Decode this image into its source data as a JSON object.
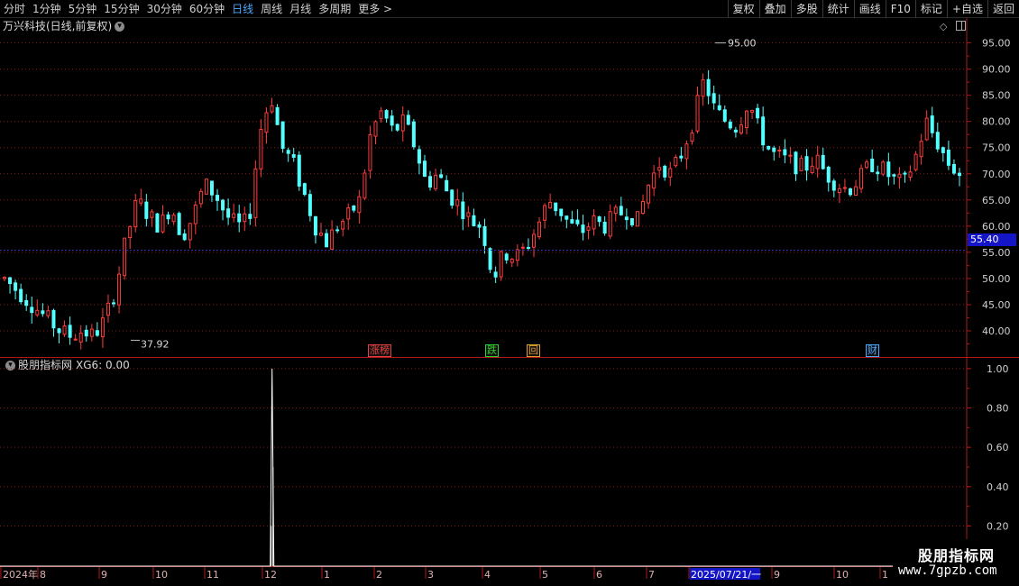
{
  "toolbar": {
    "timeframes": [
      "分时",
      "1分钟",
      "5分钟",
      "15分钟",
      "30分钟",
      "60分钟",
      "日线",
      "周线",
      "月线",
      "多周期",
      "更多 >"
    ],
    "active_index": 6,
    "tools": [
      "复权",
      "叠加",
      "多股",
      "统计",
      "画线",
      "F10",
      "标记",
      "+自选",
      "返回"
    ]
  },
  "main_chart": {
    "title": "万兴科技(日线,前复权)",
    "high_label": "95.00",
    "low_label": "37.92",
    "current_price": "55.40",
    "y_ticks": [
      "95.00",
      "90.00",
      "85.00",
      "80.00",
      "75.00",
      "70.00",
      "65.00",
      "60.00",
      "55.00",
      "50.00",
      "45.00",
      "40.00"
    ],
    "events": [
      {
        "text": "涨榜",
        "color": "#e84040"
      },
      {
        "text": "跌",
        "color": "#30d030"
      },
      {
        "text": "回",
        "color": "#e0a030"
      },
      {
        "text": "财",
        "color": "#4aa8ff"
      }
    ]
  },
  "indicator": {
    "title": "股朋指标网",
    "value_label": "XG6: 0.00",
    "y_ticks": [
      "1.00",
      "0.80",
      "0.60",
      "0.40",
      "0.20"
    ]
  },
  "time_axis": {
    "labels": [
      "2024年",
      "8",
      "9",
      "10",
      "11",
      "12",
      "1",
      "2",
      "3",
      "4",
      "5",
      "6",
      "7",
      "2025/07/21/一",
      "9",
      "10",
      "1"
    ]
  },
  "watermark": {
    "title": "股朋指标网",
    "url": "www.7gpzb.com"
  },
  "colors": {
    "up": "#ff3c3c",
    "down": "#54ffff",
    "grid": "#8a1a1a",
    "axis": "#b01818",
    "highlight": "#1515c8"
  },
  "chart_data": [
    {
      "type": "candlestick",
      "title": "万兴科技(日线,前复权)",
      "ylim": [
        35,
        97
      ],
      "approx_close_path": [
        50,
        48,
        46,
        44,
        42,
        40,
        39,
        40,
        39,
        42,
        48,
        58,
        65,
        62,
        60,
        64,
        58,
        62,
        68,
        66,
        62,
        60,
        61,
        78,
        85,
        75,
        72,
        66,
        60,
        57,
        60,
        62,
        65,
        78,
        82,
        78,
        80,
        75,
        68,
        70,
        66,
        64,
        61,
        60,
        50,
        55,
        54,
        56,
        60,
        65,
        63,
        60,
        59,
        61,
        60,
        62,
        63,
        61,
        68,
        72,
        70,
        74,
        80,
        88,
        82,
        80,
        79,
        84,
        78,
        74,
        73,
        72,
        71,
        73,
        70,
        68,
        67,
        69,
        72,
        71,
        69,
        68,
        73,
        80,
        76,
        72,
        70
      ]
    },
    {
      "type": "line",
      "title": "XG6",
      "ylim": [
        0,
        1.05
      ],
      "series": [
        {
          "name": "XG6",
          "spikes_at_fraction": [
            0.267
          ],
          "values_note_value": 1
        }
      ]
    }
  ]
}
